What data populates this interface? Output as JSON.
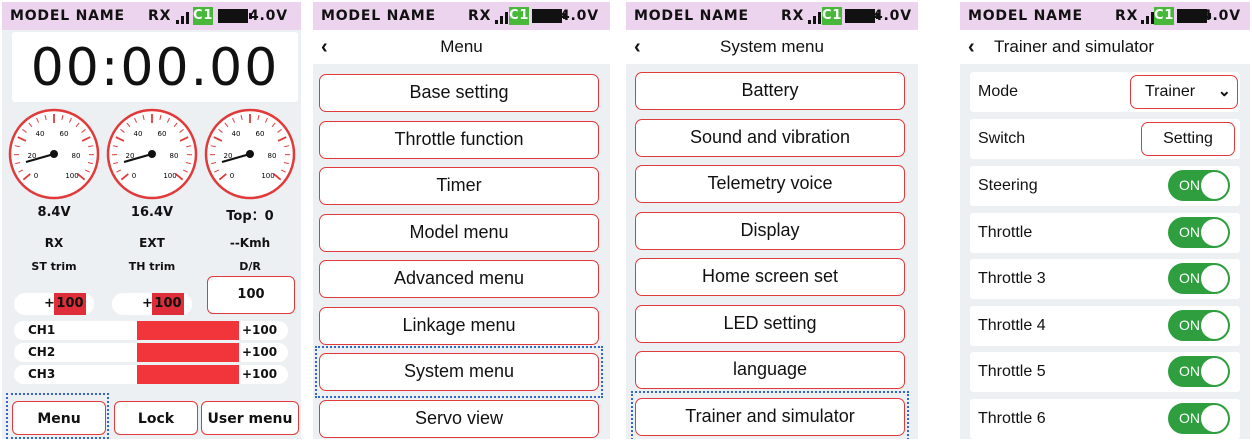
{
  "status_bar": {
    "model_name": "MODEL NAME",
    "rx": "RX",
    "channel": "C1",
    "voltage": "4.0V"
  },
  "colors": {
    "status_bg": "#ecd3ee",
    "channel_badge": "#47b83a",
    "accent_red": "#e03a3a",
    "toggle_on": "#2e9e3e",
    "focus_outline": "#3366cc"
  },
  "home": {
    "timer": "00:00.00",
    "gauges": [
      {
        "label_top": "8.4V",
        "label_mid": "RX"
      },
      {
        "label_top": "16.4V",
        "label_mid": "EXT"
      },
      {
        "label_top": "Top：0",
        "label_mid": "--Kmh"
      }
    ],
    "gauge_ticks": [
      "20",
      "40",
      "60",
      "80",
      "100",
      "0"
    ],
    "trims": [
      {
        "label": "ST trim",
        "sign": "+",
        "value": "100"
      },
      {
        "label": "TH trim",
        "sign": "+",
        "value": "100"
      }
    ],
    "dr": {
      "label": "D/R",
      "value": "100"
    },
    "channels": [
      {
        "name": "CH1",
        "value": "+100"
      },
      {
        "name": "CH2",
        "value": "+100"
      },
      {
        "name": "CH3",
        "value": "+100"
      }
    ],
    "buttons": {
      "menu": "Menu",
      "lock": "Lock",
      "user_menu": "User menu"
    }
  },
  "menu": {
    "title": "Menu",
    "back_icon": "chevron-left-icon",
    "items": [
      "Base setting",
      "Throttle function",
      "Timer",
      "Model menu",
      "Advanced menu",
      "Linkage menu",
      "System menu",
      "Servo view"
    ],
    "selected": "System menu"
  },
  "system_menu": {
    "title": "System menu",
    "items": [
      "Battery",
      "Sound and vibration",
      "Telemetry voice",
      "Display",
      "Home screen set",
      "LED setting",
      "language",
      "Trainer and simulator"
    ],
    "selected": "Trainer and simulator"
  },
  "trainer": {
    "title": "Trainer and simulator",
    "mode": {
      "label": "Mode",
      "value": "Trainer"
    },
    "switch": {
      "label": "Switch",
      "value": "Setting"
    },
    "toggles": [
      {
        "label": "Steering",
        "state": "ON"
      },
      {
        "label": "Throttle",
        "state": "ON"
      },
      {
        "label": "Throttle 3",
        "state": "ON"
      },
      {
        "label": "Throttle 4",
        "state": "ON"
      },
      {
        "label": "Throttle 5",
        "state": "ON"
      },
      {
        "label": "Throttle 6",
        "state": "ON"
      }
    ]
  }
}
